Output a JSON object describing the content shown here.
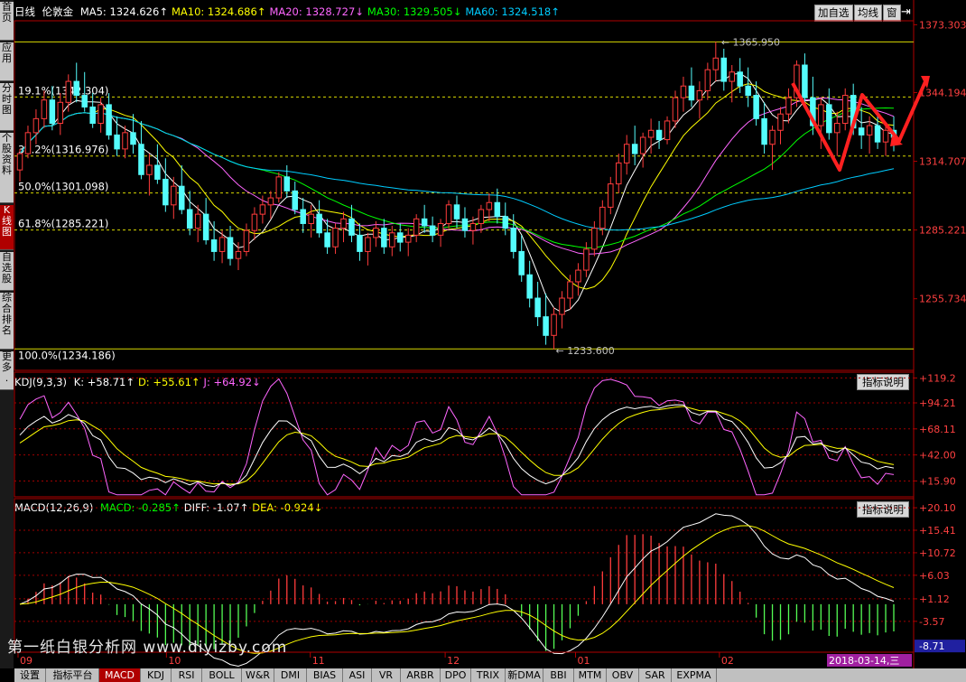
{
  "sidebar": [
    {
      "label": "首页",
      "active": false
    },
    {
      "label": "应用",
      "active": false
    },
    {
      "label": "分时图",
      "active": false
    },
    {
      "label": "个股资料",
      "active": false
    },
    {
      "label": "K线图",
      "active": true
    },
    {
      "label": "自选股",
      "active": false
    },
    {
      "label": "综合排名",
      "active": false
    },
    {
      "label": "更多.",
      "active": false
    }
  ],
  "header": {
    "period": "日线",
    "name": "伦敦金",
    "ma": [
      {
        "label": "MA5: 1324.626↑",
        "color": "#ffffff"
      },
      {
        "label": "MA10: 1324.686↑",
        "color": "#ffff00"
      },
      {
        "label": "MA20: 1328.727↓",
        "color": "#ff66ff"
      },
      {
        "label": "MA30: 1329.505↓",
        "color": "#00ff00"
      },
      {
        "label": "MA60: 1324.518↑",
        "color": "#00ccff"
      }
    ]
  },
  "top_buttons": [
    "加自选",
    "均线",
    "窗"
  ],
  "price_axis": [
    "1373.303",
    "1344.194",
    "1314.707",
    "1285.221",
    "1255.734"
  ],
  "fib_labels": [
    "19.1%(1342.304)",
    "38.2%(1316.976)",
    "50.0%(1301.098)",
    "61.8%(1285.221)",
    "100.0%(1234.186)"
  ],
  "annotations": {
    "high": "1365.950",
    "low": "1233.600"
  },
  "kdj": {
    "title": "KDJ(9,3,3)",
    "values": [
      {
        "label": "K: +58.71↑",
        "color": "#ffffff"
      },
      {
        "label": "D: +55.61↑",
        "color": "#ffff00"
      },
      {
        "label": "J: +64.92↓",
        "color": "#ff66ff"
      }
    ],
    "axis": [
      "+119.2",
      "+94.21",
      "+68.11",
      "+42.00",
      "+15.90"
    ],
    "button": "指标说明"
  },
  "macd": {
    "title": "MACD(12,26,9)",
    "values": [
      {
        "label": "MACD: -0.285↑",
        "color": "#00ff00"
      },
      {
        "label": "DIFF: -1.07↑",
        "color": "#ffffff"
      },
      {
        "label": "DEA: -0.924↓",
        "color": "#ffff00"
      }
    ],
    "axis": [
      "+20.10",
      "+15.41",
      "+10.72",
      "+6.03",
      "+1.12",
      "-3.57"
    ],
    "axis_current": "-8.71",
    "button": "指标说明"
  },
  "x_axis": [
    "09",
    "10",
    "11",
    "12",
    "01",
    "02"
  ],
  "current_date": "2018-03-14,三",
  "watermark": "第一纸白银分析网  www.diyizby.com",
  "settings_label": "设置",
  "tabs": [
    "指标平台",
    "MACD",
    "KDJ",
    "RSI",
    "BOLL",
    "W&R",
    "DMI",
    "BIAS",
    "ASI",
    "VR",
    "ARBR",
    "DPO",
    "TRIX",
    "新DMA",
    "BBI",
    "MTM",
    "OBV",
    "SAR",
    "EXPMA"
  ],
  "active_tab": "MACD",
  "chart_data": [
    {
      "type": "candlestick",
      "title": "伦敦金 日线",
      "ylim": [
        1225,
        1375
      ],
      "series": [
        {
          "name": "MA5",
          "color": "#ffffff"
        },
        {
          "name": "MA10",
          "color": "#ffff00"
        },
        {
          "name": "MA20",
          "color": "#ff66ff"
        },
        {
          "name": "MA30",
          "color": "#00ff00"
        },
        {
          "name": "MA60",
          "color": "#00ccff"
        }
      ],
      "fib_levels": [
        1342.304,
        1316.976,
        1301.098,
        1285.221,
        1234.186
      ],
      "high": 1365.95,
      "low": 1233.6,
      "ohlc": [
        [
          1311,
          1320,
          1306,
          1318
        ],
        [
          1318,
          1330,
          1316,
          1327
        ],
        [
          1327,
          1337,
          1322,
          1333
        ],
        [
          1333,
          1345,
          1329,
          1341
        ],
        [
          1341,
          1347,
          1328,
          1331
        ],
        [
          1331,
          1344,
          1326,
          1340
        ],
        [
          1340,
          1352,
          1336,
          1349
        ],
        [
          1349,
          1357,
          1340,
          1343
        ],
        [
          1343,
          1353,
          1336,
          1338
        ],
        [
          1338,
          1344,
          1329,
          1331
        ],
        [
          1331,
          1342,
          1327,
          1339
        ],
        [
          1339,
          1344,
          1324,
          1326
        ],
        [
          1326,
          1334,
          1317,
          1320
        ],
        [
          1320,
          1330,
          1316,
          1327
        ],
        [
          1327,
          1335,
          1318,
          1322
        ],
        [
          1322,
          1332,
          1307,
          1309
        ],
        [
          1309,
          1318,
          1300,
          1313
        ],
        [
          1313,
          1322,
          1305,
          1307
        ],
        [
          1307,
          1316,
          1293,
          1296
        ],
        [
          1296,
          1308,
          1290,
          1304
        ],
        [
          1304,
          1313,
          1292,
          1294
        ],
        [
          1294,
          1302,
          1283,
          1286
        ],
        [
          1286,
          1296,
          1280,
          1292
        ],
        [
          1292,
          1299,
          1279,
          1281
        ],
        [
          1281,
          1289,
          1272,
          1276
        ],
        [
          1276,
          1285,
          1271,
          1282
        ],
        [
          1282,
          1287,
          1270,
          1273
        ],
        [
          1273,
          1280,
          1268,
          1276
        ],
        [
          1276,
          1288,
          1274,
          1285
        ],
        [
          1285,
          1295,
          1281,
          1292
        ],
        [
          1292,
          1300,
          1288,
          1296
        ],
        [
          1296,
          1302,
          1290,
          1299
        ],
        [
          1299,
          1310,
          1297,
          1308
        ],
        [
          1308,
          1313,
          1299,
          1302
        ],
        [
          1302,
          1306,
          1292,
          1294
        ],
        [
          1294,
          1299,
          1284,
          1288
        ],
        [
          1288,
          1296,
          1282,
          1292
        ],
        [
          1292,
          1298,
          1282,
          1284
        ],
        [
          1284,
          1290,
          1275,
          1278
        ],
        [
          1278,
          1288,
          1275,
          1286
        ],
        [
          1286,
          1293,
          1280,
          1290
        ],
        [
          1290,
          1296,
          1280,
          1283
        ],
        [
          1283,
          1288,
          1272,
          1276
        ],
        [
          1276,
          1284,
          1270,
          1282
        ],
        [
          1282,
          1289,
          1278,
          1286
        ],
        [
          1286,
          1290,
          1275,
          1278
        ],
        [
          1278,
          1287,
          1274,
          1284
        ],
        [
          1284,
          1288,
          1276,
          1280
        ],
        [
          1280,
          1286,
          1274,
          1283
        ],
        [
          1283,
          1292,
          1280,
          1290
        ],
        [
          1290,
          1296,
          1284,
          1287
        ],
        [
          1287,
          1291,
          1280,
          1283
        ],
        [
          1283,
          1290,
          1278,
          1288
        ],
        [
          1288,
          1298,
          1286,
          1296
        ],
        [
          1296,
          1300,
          1286,
          1290
        ],
        [
          1290,
          1295,
          1282,
          1285
        ],
        [
          1285,
          1291,
          1279,
          1288
        ],
        [
          1288,
          1296,
          1284,
          1294
        ],
        [
          1294,
          1301,
          1289,
          1297
        ],
        [
          1297,
          1303,
          1288,
          1291
        ],
        [
          1291,
          1297,
          1283,
          1286
        ],
        [
          1286,
          1292,
          1273,
          1276
        ],
        [
          1276,
          1283,
          1263,
          1266
        ],
        [
          1266,
          1272,
          1252,
          1256
        ],
        [
          1256,
          1263,
          1244,
          1248
        ],
        [
          1248,
          1258,
          1236,
          1240
        ],
        [
          1240,
          1252,
          1234,
          1249
        ],
        [
          1249,
          1259,
          1243,
          1256
        ],
        [
          1256,
          1266,
          1251,
          1263
        ],
        [
          1263,
          1271,
          1257,
          1268
        ],
        [
          1268,
          1280,
          1265,
          1277
        ],
        [
          1277,
          1289,
          1274,
          1286
        ],
        [
          1286,
          1298,
          1283,
          1295
        ],
        [
          1295,
          1308,
          1292,
          1305
        ],
        [
          1305,
          1318,
          1301,
          1314
        ],
        [
          1314,
          1326,
          1309,
          1322
        ],
        [
          1322,
          1330,
          1313,
          1318
        ],
        [
          1318,
          1327,
          1312,
          1325
        ],
        [
          1325,
          1333,
          1318,
          1328
        ],
        [
          1328,
          1332,
          1320,
          1324
        ],
        [
          1324,
          1334,
          1322,
          1332
        ],
        [
          1332,
          1345,
          1329,
          1342
        ],
        [
          1342,
          1351,
          1336,
          1347
        ],
        [
          1347,
          1355,
          1338,
          1341
        ],
        [
          1341,
          1349,
          1333,
          1345
        ],
        [
          1345,
          1357,
          1341,
          1354
        ],
        [
          1354,
          1366,
          1349,
          1359
        ],
        [
          1359,
          1363,
          1345,
          1349
        ],
        [
          1349,
          1356,
          1340,
          1353
        ],
        [
          1353,
          1359,
          1344,
          1347
        ],
        [
          1347,
          1355,
          1338,
          1343
        ],
        [
          1343,
          1349,
          1330,
          1333
        ],
        [
          1333,
          1340,
          1318,
          1322
        ],
        [
          1322,
          1330,
          1311,
          1328
        ],
        [
          1328,
          1338,
          1322,
          1335
        ],
        [
          1335,
          1346,
          1331,
          1342
        ],
        [
          1342,
          1358,
          1338,
          1356
        ],
        [
          1356,
          1361,
          1339,
          1342
        ],
        [
          1342,
          1351,
          1326,
          1330
        ],
        [
          1330,
          1342,
          1320,
          1339
        ],
        [
          1339,
          1346,
          1324,
          1327
        ],
        [
          1327,
          1336,
          1317,
          1331
        ],
        [
          1331,
          1346,
          1328,
          1343
        ],
        [
          1343,
          1348,
          1326,
          1329
        ],
        [
          1329,
          1338,
          1320,
          1326
        ],
        [
          1326,
          1334,
          1318,
          1330
        ],
        [
          1330,
          1336,
          1320,
          1323
        ],
        [
          1323,
          1331,
          1317,
          1328
        ],
        [
          1328,
          1334,
          1319,
          1325
        ]
      ]
    },
    {
      "type": "line",
      "title": "KDJ(9,3,3)",
      "ylim": [
        0,
        125
      ],
      "series": [
        {
          "name": "K",
          "color": "#ffffff"
        },
        {
          "name": "D",
          "color": "#ffff00"
        },
        {
          "name": "J",
          "color": "#ff66ff"
        }
      ],
      "last": {
        "K": 58.71,
        "D": 55.61,
        "J": 64.92
      }
    },
    {
      "type": "bar",
      "title": "MACD(12,26,9)",
      "ylim": [
        -10,
        22
      ],
      "series": [
        {
          "name": "DIFF",
          "color": "#ffffff"
        },
        {
          "name": "DEA",
          "color": "#ffff00"
        },
        {
          "name": "MACD",
          "color": "#ff3333"
        }
      ],
      "last": {
        "MACD": -0.285,
        "DIFF": -1.07,
        "DEA": -0.924
      }
    }
  ]
}
